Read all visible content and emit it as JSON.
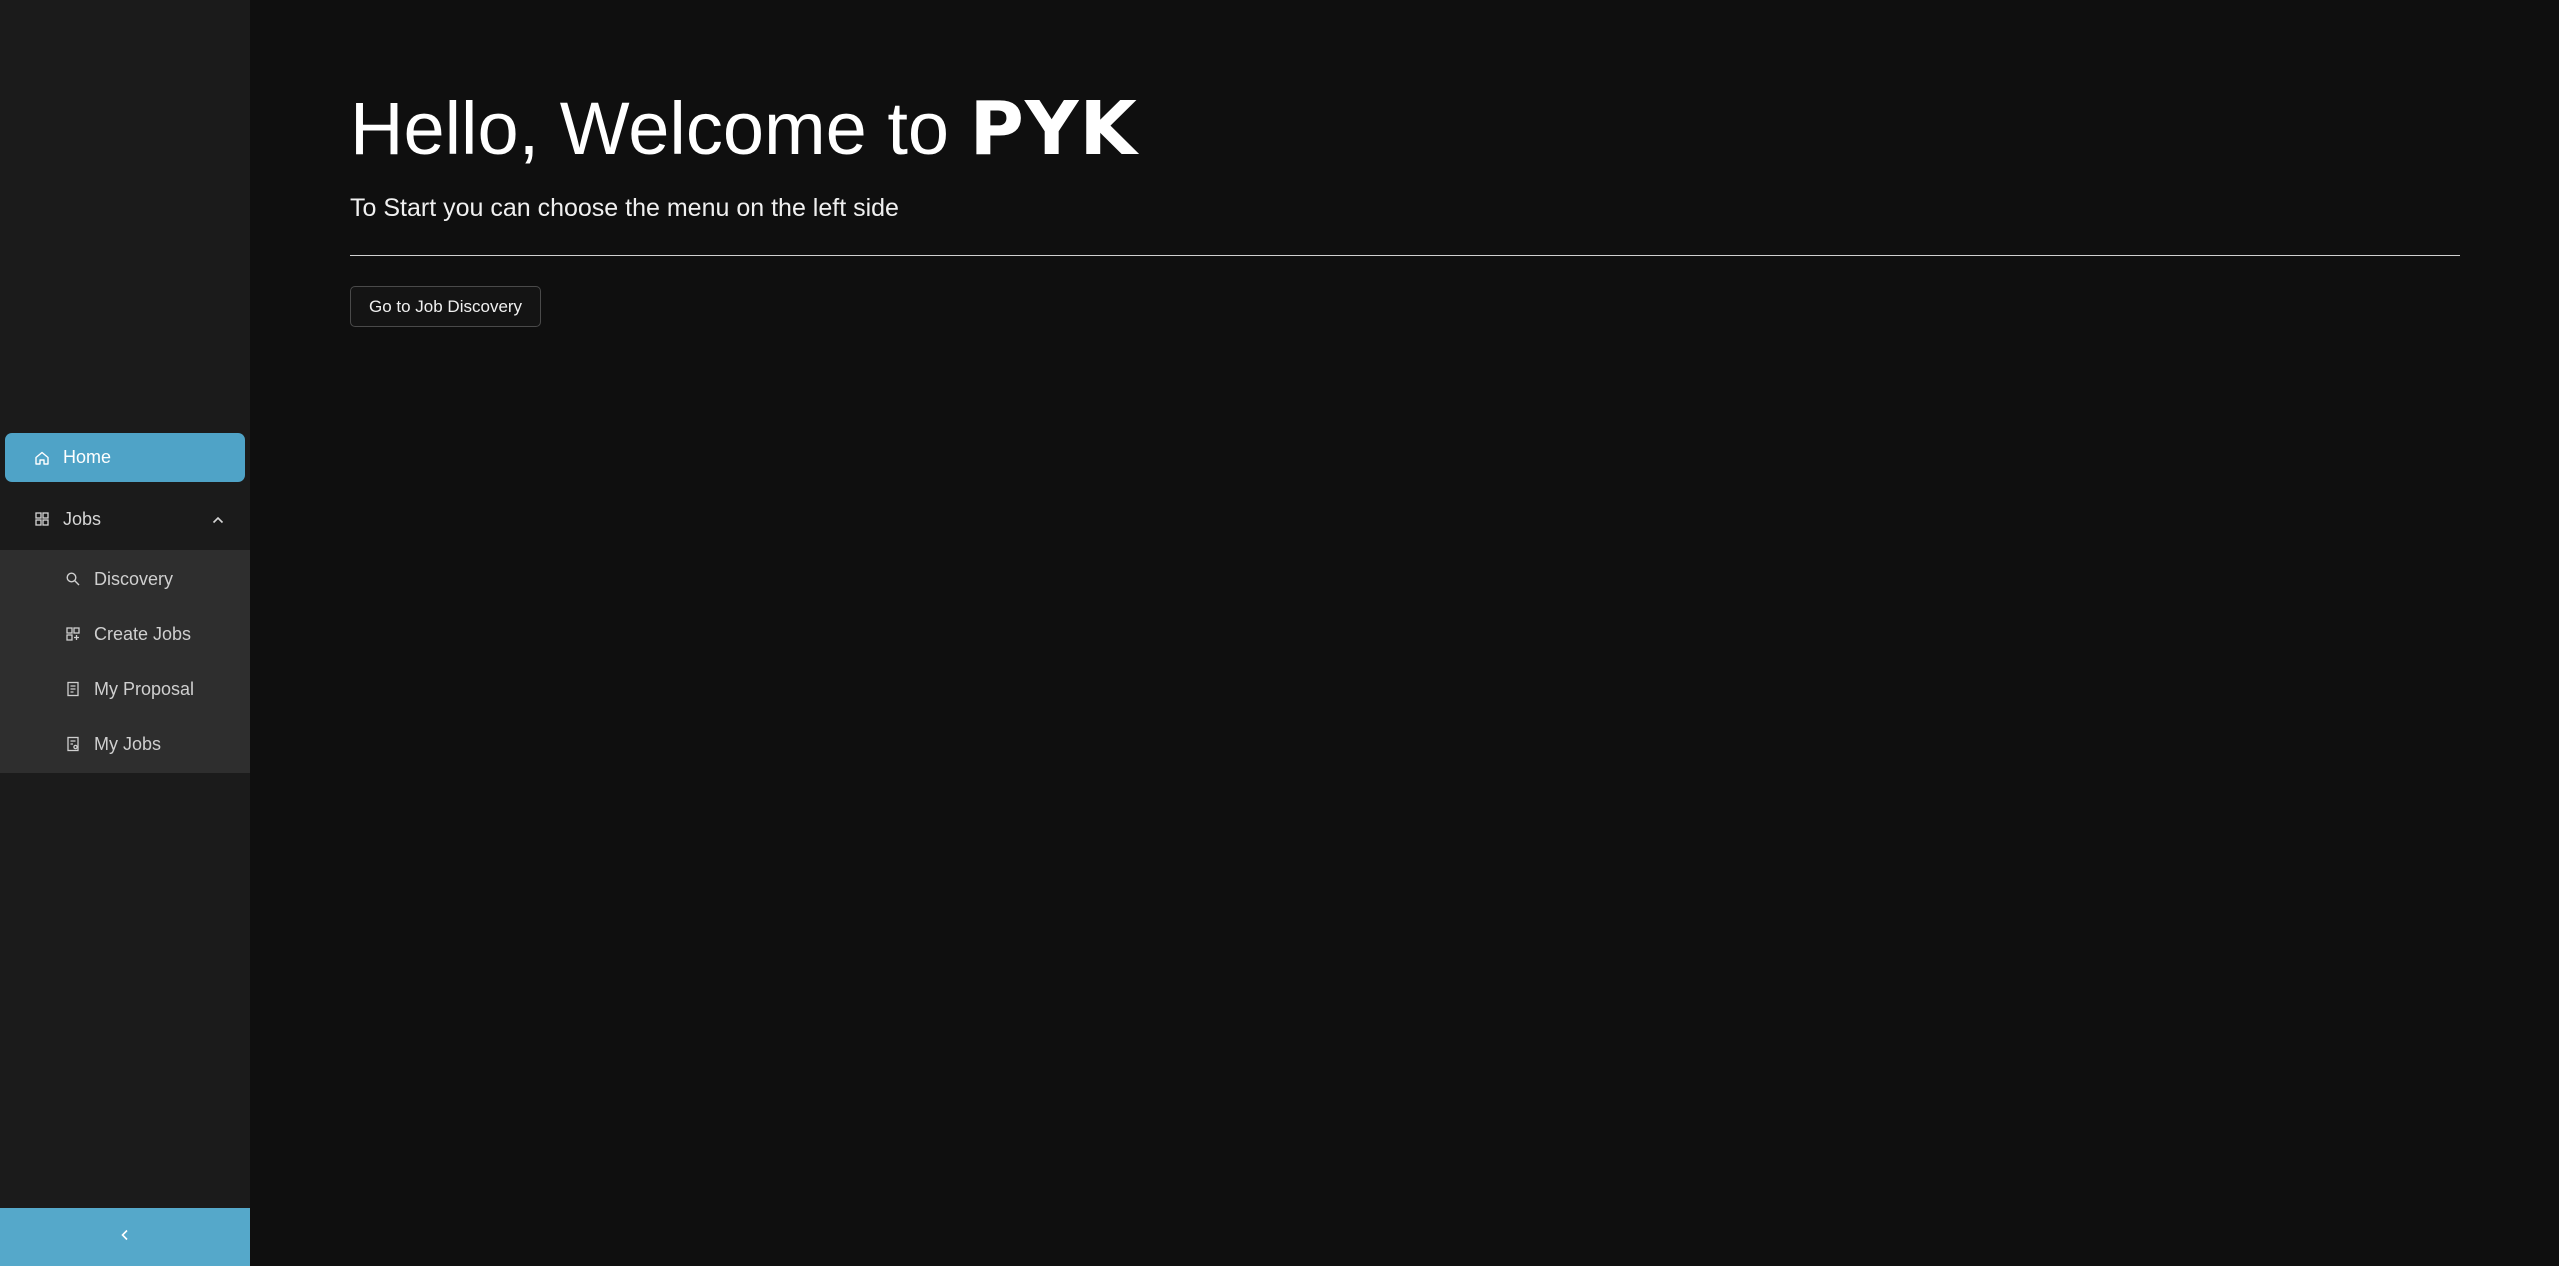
{
  "colors": {
    "background": "#0f0f0f",
    "sidebar": "#1b1b1b",
    "submenu": "#2e2e2e",
    "accent": "#4fa3c7"
  },
  "sidebar": {
    "home": {
      "label": "Home",
      "icon": "home-icon",
      "active": true
    },
    "jobs": {
      "label": "Jobs",
      "icon": "grid-icon",
      "expanded": true,
      "items": [
        {
          "label": "Discovery",
          "icon": "search-icon"
        },
        {
          "label": "Create Jobs",
          "icon": "create-jobs-icon"
        },
        {
          "label": "My Proposal",
          "icon": "document-icon"
        },
        {
          "label": "My Jobs",
          "icon": "jobs-document-icon"
        }
      ]
    },
    "collapse": {
      "icon": "chevron-left-icon"
    }
  },
  "main": {
    "title_prefix": "Hello, Welcome to",
    "title_brand": "PYK",
    "subtitle": "To Start you can choose the menu on the left side",
    "cta_label": "Go to Job Discovery"
  }
}
